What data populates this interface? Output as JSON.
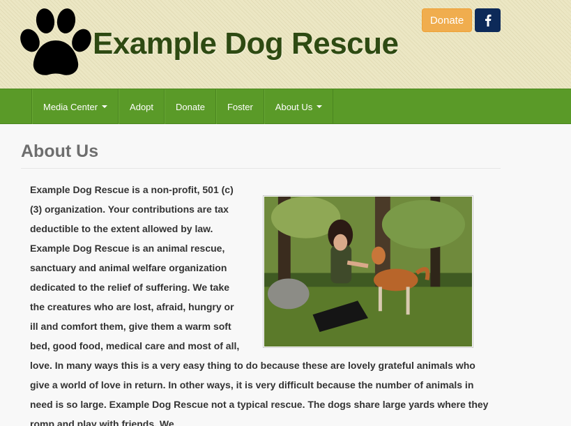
{
  "header": {
    "site_title": "Example Dog Rescue",
    "donate_label": "Donate",
    "facebook_icon": "facebook-icon",
    "logo_icon": "paw-icon"
  },
  "nav": {
    "items": [
      {
        "label": "Media Center",
        "dropdown": true
      },
      {
        "label": "Adopt",
        "dropdown": false
      },
      {
        "label": "Donate",
        "dropdown": false
      },
      {
        "label": "Foster",
        "dropdown": false
      },
      {
        "label": "About Us",
        "dropdown": true
      }
    ]
  },
  "page": {
    "heading": "About Us",
    "body": "Example Dog Rescue is a non-profit, 501 (c) (3) organization. Your contributions are tax deductible to the extent allowed by law. Example Dog Rescue is an animal rescue, sanctuary and animal welfare organization dedicated to the relief of suffering. We take the creatures who are lost, afraid, hungry or ill and comfort them, give them a warm soft bed, good food, medical care and most of all, love. In many ways this is a very easy thing to do because these are lovely grateful animals who give a world of love in return. In other ways, it is very difficult because the number of animals in need is so large. Example Dog Rescue not a typical rescue. The dogs share large yards where they romp and play with friends. We"
  },
  "colors": {
    "nav_green": "#5a9a28",
    "title_green": "#2e4a12",
    "donate_orange": "#f0ad4e",
    "facebook_navy": "#0d2a59"
  }
}
